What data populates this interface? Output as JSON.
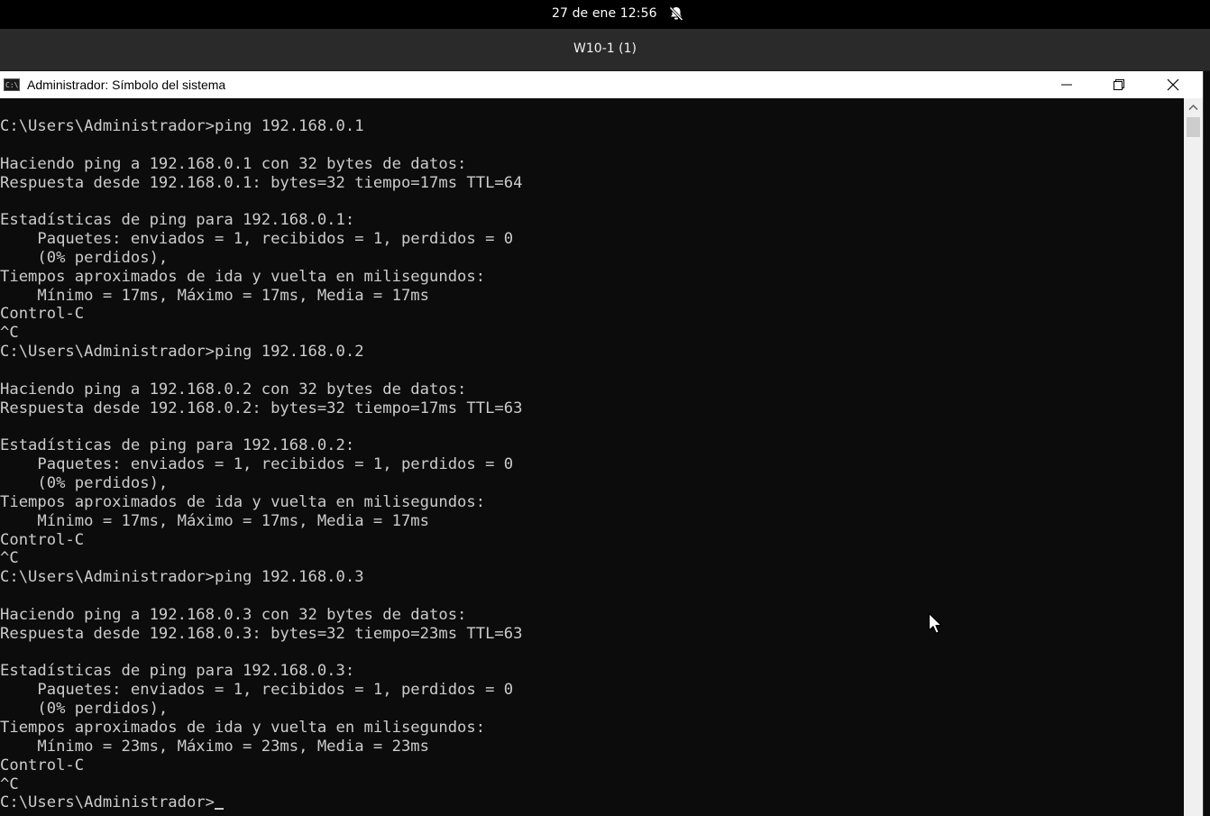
{
  "system_bar": {
    "datetime": "27 de ene  12:56",
    "notification_icon": "bell-slash-icon"
  },
  "vm_window": {
    "title": "W10-1 (1)"
  },
  "cmd_window": {
    "title": "Administrador: Símbolo del sistema",
    "app_icon_text": "C:\\",
    "buttons": {
      "minimize_icon": "minimize-icon",
      "maximize_icon": "restore-icon",
      "close_icon": "close-icon"
    }
  },
  "console": {
    "lines": [
      "C:\\Users\\Administrador>ping 192.168.0.1",
      "",
      "Haciendo ping a 192.168.0.1 con 32 bytes de datos:",
      "Respuesta desde 192.168.0.1: bytes=32 tiempo=17ms TTL=64",
      "",
      "Estadísticas de ping para 192.168.0.1:",
      "    Paquetes: enviados = 1, recibidos = 1, perdidos = 0",
      "    (0% perdidos),",
      "Tiempos aproximados de ida y vuelta en milisegundos:",
      "    Mínimo = 17ms, Máximo = 17ms, Media = 17ms",
      "Control-C",
      "^C",
      "C:\\Users\\Administrador>ping 192.168.0.2",
      "",
      "Haciendo ping a 192.168.0.2 con 32 bytes de datos:",
      "Respuesta desde 192.168.0.2: bytes=32 tiempo=17ms TTL=63",
      "",
      "Estadísticas de ping para 192.168.0.2:",
      "    Paquetes: enviados = 1, recibidos = 1, perdidos = 0",
      "    (0% perdidos),",
      "Tiempos aproximados de ida y vuelta en milisegundos:",
      "    Mínimo = 17ms, Máximo = 17ms, Media = 17ms",
      "Control-C",
      "^C",
      "C:\\Users\\Administrador>ping 192.168.0.3",
      "",
      "Haciendo ping a 192.168.0.3 con 32 bytes de datos:",
      "Respuesta desde 192.168.0.3: bytes=32 tiempo=23ms TTL=63",
      "",
      "Estadísticas de ping para 192.168.0.3:",
      "    Paquetes: enviados = 1, recibidos = 1, perdidos = 0",
      "    (0% perdidos),",
      "Tiempos aproximados de ida y vuelta en milisegundos:",
      "    Mínimo = 23ms, Máximo = 23ms, Media = 23ms",
      "Control-C",
      "^C"
    ],
    "prompt": "C:\\Users\\Administrador>",
    "text_color": "#cccccc",
    "background_color": "#0c0c0c"
  }
}
